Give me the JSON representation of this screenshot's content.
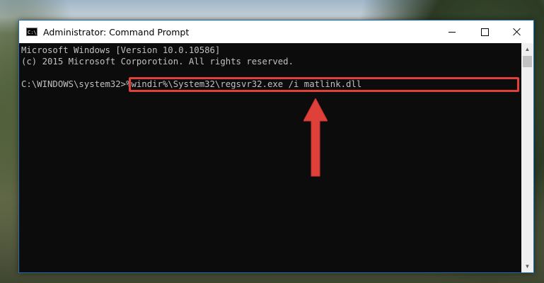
{
  "window": {
    "title": "Administrator: Command Prompt",
    "icon_label": "C:\\",
    "controls": {
      "minimize": "minimize-icon",
      "maximize": "maximize-icon",
      "close": "close-icon"
    }
  },
  "console": {
    "lines": [
      "Microsoft Windows [Version 10.0.10586]",
      "(c) 2015 Microsoft Corporotion. All rights reserved."
    ],
    "prompt": "C:\\WINDOWS\\system32>",
    "command": "%windir%\\System32\\regsvr32.exe /i matlink.dll"
  },
  "annotation": {
    "highlight_color": "#e0403a",
    "arrow_color": "#e0403a",
    "arrow_icon": "up-arrow-icon"
  },
  "colors": {
    "console_bg": "#0c0c0c",
    "console_text": "#c0c0c0",
    "window_border": "#1f6fb8"
  }
}
